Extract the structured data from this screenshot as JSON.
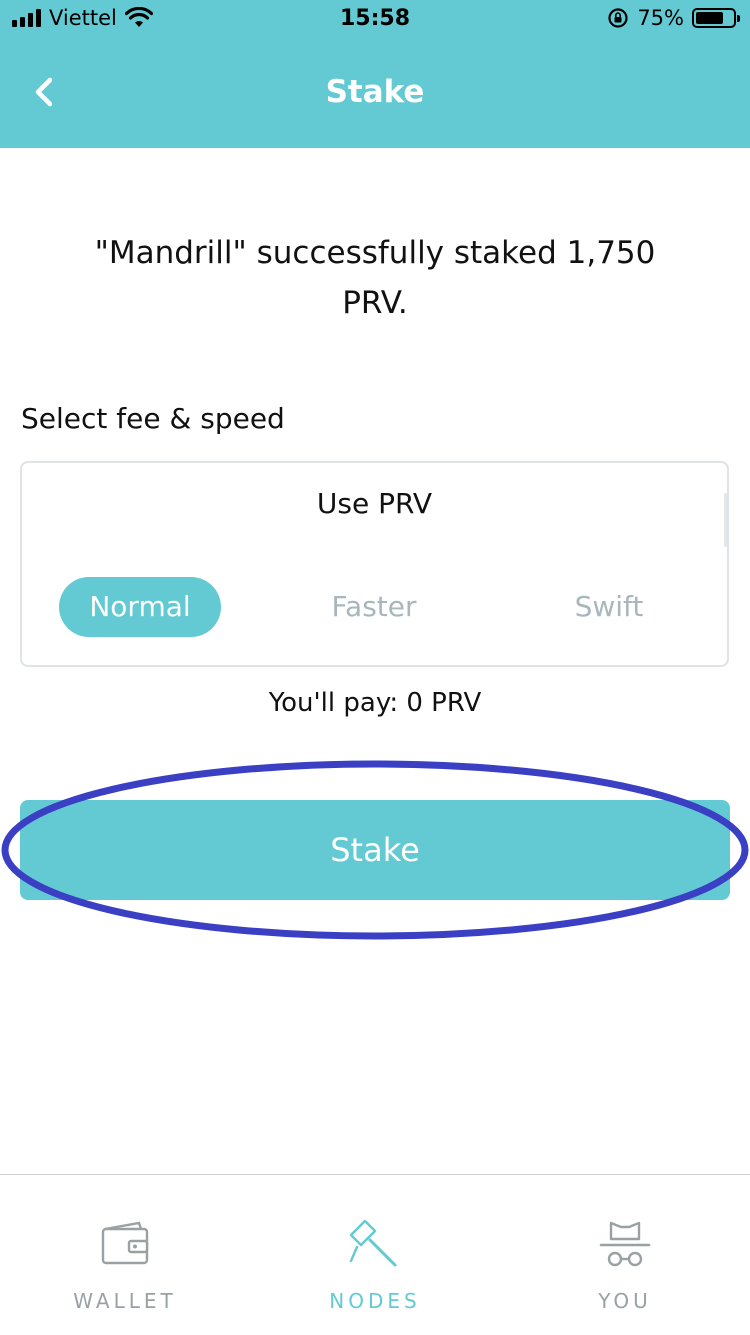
{
  "status_bar": {
    "carrier": "Viettel",
    "time": "15:58",
    "battery": "75%",
    "battery_level": 0.75
  },
  "header": {
    "title": "Stake",
    "back_icon": "chevron-left-icon"
  },
  "message": "\"Mandrill\" successfully staked 1,750 PRV.",
  "fee": {
    "label": "Select fee & speed",
    "card_title": "Use PRV",
    "options": [
      "Normal",
      "Faster",
      "Swift"
    ],
    "selected": "Normal"
  },
  "pay_text": "You'll pay: 0 PRV",
  "stake_button": "Stake",
  "tabs": [
    {
      "label": "WALLET",
      "icon": "wallet-icon",
      "active": false
    },
    {
      "label": "NODES",
      "icon": "pickaxe-icon",
      "active": true
    },
    {
      "label": "YOU",
      "icon": "incognito-icon",
      "active": false
    }
  ],
  "colors": {
    "accent": "#63cad3",
    "inactive_tab": "#9aa1a5",
    "inactive_option": "#a7b7bc",
    "highlight": "#3a3fc4"
  }
}
